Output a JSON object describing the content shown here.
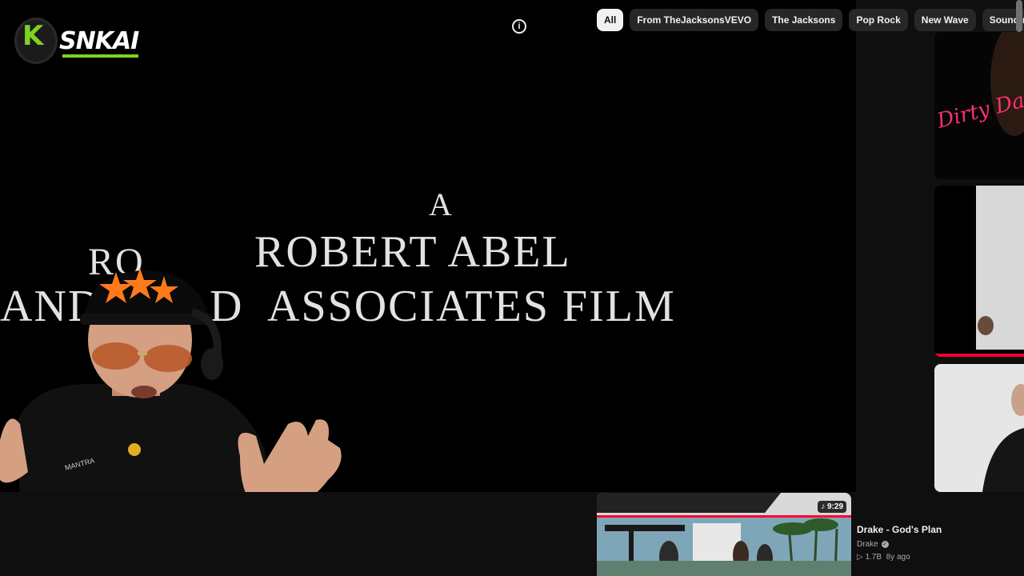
{
  "chips": [
    {
      "label": "All",
      "active": true
    },
    {
      "label": "From TheJacksonsVEVO",
      "active": false
    },
    {
      "label": "The Jacksons",
      "active": false
    },
    {
      "label": "Pop Rock",
      "active": false
    },
    {
      "label": "New Wave",
      "active": false
    },
    {
      "label": "Soundtracks",
      "active": false
    }
  ],
  "video": {
    "frame_text": {
      "line_a": "A",
      "line_robert": "ROBERT ABEL",
      "line_ro": "RO",
      "line_and": "AND",
      "line_d": "D",
      "line_associates": "ASSOCIATES FILM"
    }
  },
  "overlay": {
    "logo_text": "SNKAI"
  },
  "controls": [
    "pause-icon",
    "captions-icon",
    "loop-icon",
    "settings-icon",
    "miniplayer-icon",
    "fullscreen-icon"
  ],
  "recommendation": {
    "duration": "9:29",
    "title": "Drake - God's Plan",
    "channel": "Drake",
    "views": "1.7B",
    "age": "8y ago"
  },
  "side_thumbnails": {
    "thumb1_text": "Dirty Danc"
  },
  "colors": {
    "background": "#0f0f0f",
    "chip_active_bg": "#f1f1f1",
    "chip_bg": "#272727",
    "accent_red": "#ff0033",
    "logo_green": "#7ed321"
  }
}
